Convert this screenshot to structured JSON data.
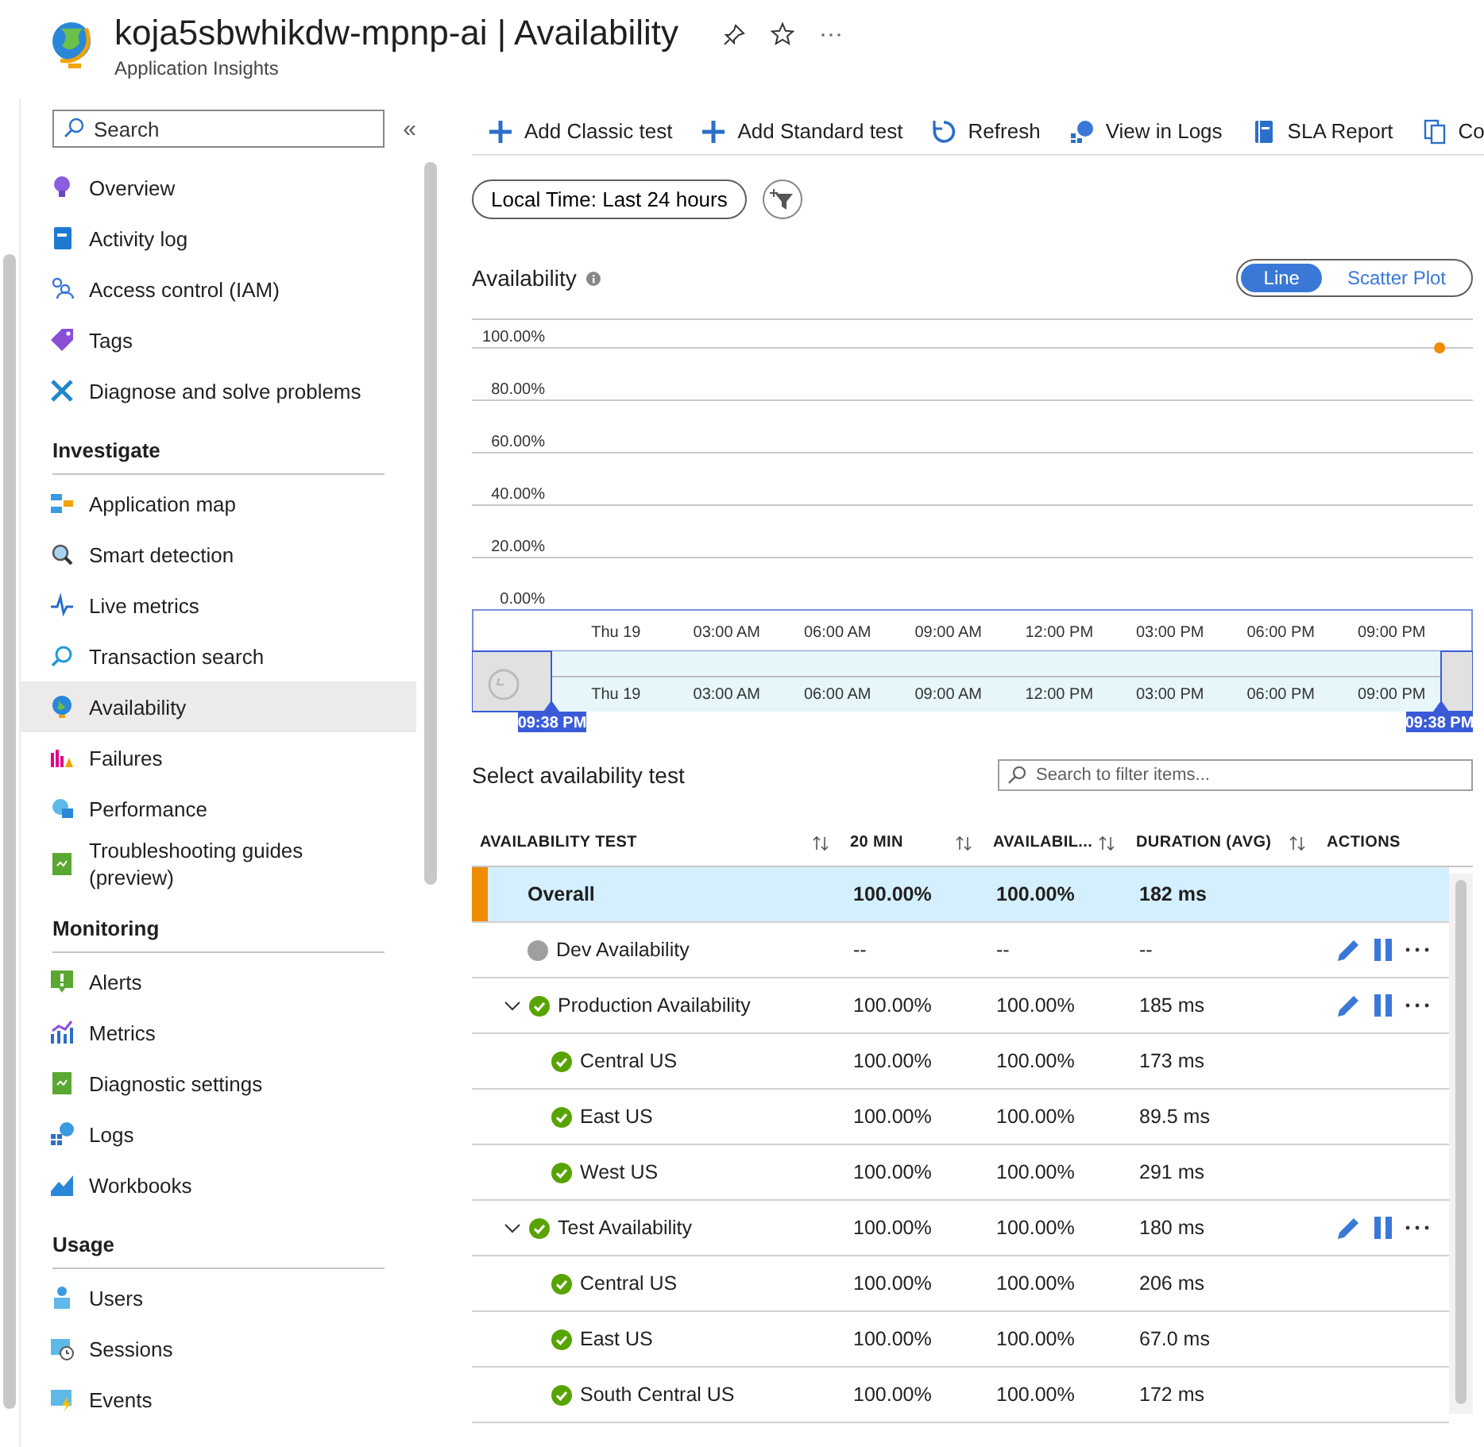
{
  "header": {
    "title": "koja5sbwhikdw-mpnp-ai | Availability",
    "subtitle": "Application Insights"
  },
  "sidebar": {
    "search": {
      "placeholder": "Search"
    },
    "collapse": "«",
    "sections": [
      {
        "items": [
          {
            "label": "Overview",
            "selected": false
          },
          {
            "label": "Activity log",
            "selected": false
          },
          {
            "label": "Access control (IAM)",
            "selected": false
          },
          {
            "label": "Tags",
            "selected": false
          },
          {
            "label": "Diagnose and solve problems",
            "selected": false
          }
        ]
      },
      {
        "title": "Investigate",
        "items": [
          {
            "label": "Application map",
            "selected": false
          },
          {
            "label": "Smart detection",
            "selected": false
          },
          {
            "label": "Live metrics",
            "selected": false
          },
          {
            "label": "Transaction search",
            "selected": false
          },
          {
            "label": "Availability",
            "selected": true
          },
          {
            "label": "Failures",
            "selected": false
          },
          {
            "label": "Performance",
            "selected": false
          },
          {
            "label": "Troubleshooting guides (preview)",
            "selected": false
          }
        ]
      },
      {
        "title": "Monitoring",
        "items": [
          {
            "label": "Alerts",
            "selected": false
          },
          {
            "label": "Metrics",
            "selected": false
          },
          {
            "label": "Diagnostic settings",
            "selected": false
          },
          {
            "label": "Logs",
            "selected": false
          },
          {
            "label": "Workbooks",
            "selected": false
          }
        ]
      },
      {
        "title": "Usage",
        "items": [
          {
            "label": "Users",
            "selected": false
          },
          {
            "label": "Sessions",
            "selected": false
          },
          {
            "label": "Events",
            "selected": false
          }
        ]
      }
    ]
  },
  "toolbar": [
    {
      "label": "Add Classic test"
    },
    {
      "label": "Add Standard test"
    },
    {
      "label": "Refresh"
    },
    {
      "label": "View in Logs"
    },
    {
      "label": "SLA Report"
    },
    {
      "label": "Co"
    }
  ],
  "filters": {
    "time": "Local Time: Last 24 hours"
  },
  "availability": {
    "title": "Availability",
    "views": [
      {
        "label": "Line",
        "selected": true
      },
      {
        "label": "Scatter Plot",
        "selected": false
      }
    ],
    "chart_data": {
      "type": "line",
      "grid": true,
      "ylim": [
        0,
        100
      ],
      "xlim": [
        -3.9,
        23.2
      ],
      "yticks": [
        {
          "value": 100,
          "label": "100.00%"
        },
        {
          "value": 80,
          "label": "80.00%"
        },
        {
          "value": 60,
          "label": "60.00%"
        },
        {
          "value": 40,
          "label": "40.00%"
        },
        {
          "value": 20,
          "label": "20.00%"
        },
        {
          "value": 0,
          "label": "0.00%"
        }
      ],
      "xticks": [
        {
          "value": 0,
          "label": "Thu 19"
        },
        {
          "value": 3,
          "label": "03:00 AM"
        },
        {
          "value": 6,
          "label": "06:00 AM"
        },
        {
          "value": 9,
          "label": "09:00 AM"
        },
        {
          "value": 12,
          "label": "12:00 PM"
        },
        {
          "value": 15,
          "label": "03:00 PM"
        },
        {
          "value": 18,
          "label": "06:00 PM"
        },
        {
          "value": 21,
          "label": "09:00 PM"
        }
      ],
      "x": [
        22.3
      ],
      "series": [
        {
          "color": "#f08c00",
          "marker": true,
          "values": [
            100
          ]
        }
      ]
    },
    "brush": {
      "ticks": [
        "Thu 19",
        "03:00 AM",
        "06:00 AM",
        "09:00 AM",
        "12:00 PM",
        "03:00 PM",
        "06:00 PM",
        "09:00 PM"
      ],
      "start": "09:38 PM",
      "end": "09:38 PM"
    }
  },
  "tests": {
    "title": "Select availability test",
    "search": {
      "placeholder": "Search to filter items..."
    },
    "columns": [
      {
        "label": "AVAILABILITY TEST",
        "sortable": true
      },
      {
        "label": "20 MIN",
        "sortable": true
      },
      {
        "label": "AVAILABIL...",
        "sortable": true
      },
      {
        "label": "DURATION (AVG)",
        "sortable": true
      },
      {
        "label": "ACTIONS",
        "sortable": false
      }
    ],
    "rows": [
      {
        "kind": "overall",
        "name": "Overall",
        "min20": "100.00%",
        "availability": "100.00%",
        "duration": "182 ms",
        "selected": true
      },
      {
        "kind": "test",
        "name": "Dev Availability",
        "passed": false,
        "min20": "--",
        "availability": "--",
        "duration": "--",
        "selected": false
      },
      {
        "kind": "test",
        "name": "Production Availability",
        "passed": true,
        "expanded": true,
        "min20": "100.00%",
        "availability": "100.00%",
        "duration": "185 ms",
        "selected": false,
        "children": [
          {
            "kind": "location",
            "name": "Central US",
            "passed": true,
            "min20": "100.00%",
            "availability": "100.00%",
            "duration": "173 ms",
            "selected": false
          },
          {
            "kind": "location",
            "name": "East US",
            "passed": true,
            "min20": "100.00%",
            "availability": "100.00%",
            "duration": "89.5 ms",
            "selected": false
          },
          {
            "kind": "location",
            "name": "West US",
            "passed": true,
            "min20": "100.00%",
            "availability": "100.00%",
            "duration": "291 ms",
            "selected": false
          }
        ]
      },
      {
        "kind": "test",
        "name": "Test Availability",
        "passed": true,
        "expanded": true,
        "min20": "100.00%",
        "availability": "100.00%",
        "duration": "180 ms",
        "selected": false,
        "children": [
          {
            "kind": "location",
            "name": "Central US",
            "passed": true,
            "min20": "100.00%",
            "availability": "100.00%",
            "duration": "206 ms",
            "selected": false
          },
          {
            "kind": "location",
            "name": "East US",
            "passed": true,
            "min20": "100.00%",
            "availability": "100.00%",
            "duration": "67.0 ms",
            "selected": false
          },
          {
            "kind": "location",
            "name": "South Central US",
            "passed": true,
            "min20": "100.00%",
            "availability": "100.00%",
            "duration": "172 ms",
            "selected": false
          }
        ]
      }
    ]
  }
}
